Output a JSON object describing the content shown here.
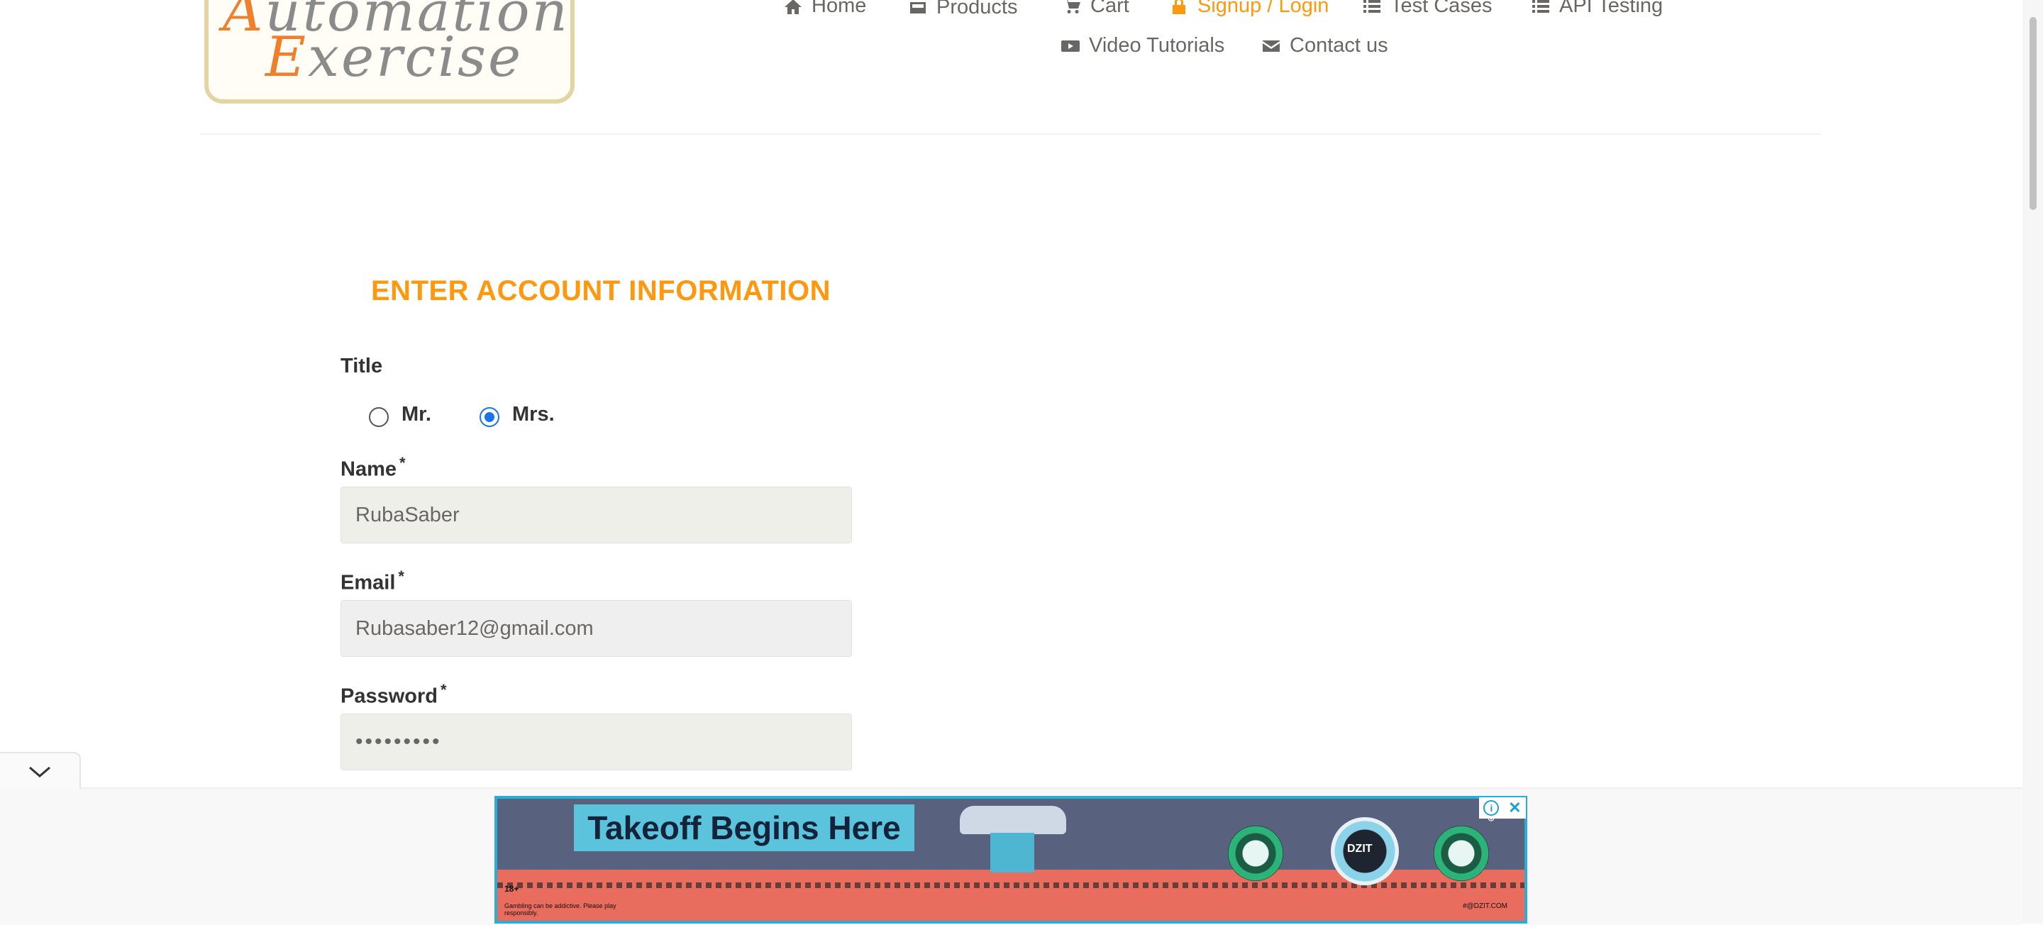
{
  "logo": {
    "line1_cap": "A",
    "line1_rest": "utomation",
    "line2_cap": "E",
    "line2_rest": "xercise"
  },
  "nav": {
    "home": "Home",
    "products": "Products",
    "cart": "Cart",
    "signup_login": "Signup / Login",
    "test_cases": "Test Cases",
    "api_testing": "API Testing",
    "video_tutorials": "Video Tutorials",
    "contact_us": "Contact us",
    "active_item": "signup_login",
    "active_color": "#fe980f"
  },
  "form": {
    "heading": "ENTER ACCOUNT INFORMATION",
    "title_label": "Title",
    "title_options": [
      {
        "label": "Mr.",
        "selected": false
      },
      {
        "label": "Mrs.",
        "selected": true
      }
    ],
    "name_label": "Name",
    "name_value": "RubaSaber",
    "email_label": "Email",
    "email_value": "Rubasaber12@gmail.com",
    "password_label": "Password",
    "password_value": "•••••••••",
    "required_marker": "*"
  },
  "ad": {
    "headline": "Takeoff Begins Here",
    "logo_text": "DZIT",
    "age_badge": "18+",
    "fine_print": "Gambling can be addictive. Please play responsibly.",
    "fine_print_right": "#@DZIT.COM",
    "info_glyph": "i",
    "close_glyph": "✕"
  },
  "icons": {
    "home": "home-icon",
    "products": "products-icon",
    "cart": "cart-icon",
    "lock": "lock-icon",
    "list": "list-icon",
    "youtube": "youtube-icon",
    "envelope": "envelope-icon",
    "collapse": "chevron-down-icon"
  }
}
